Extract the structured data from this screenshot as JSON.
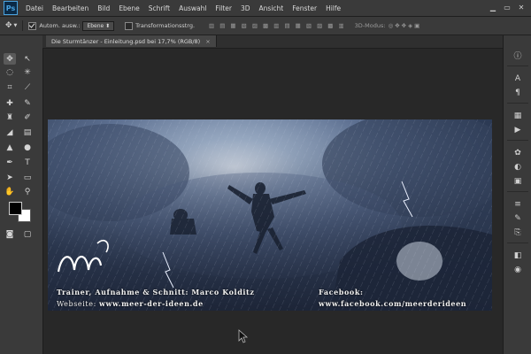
{
  "app": {
    "logo": "Ps"
  },
  "menubar": {
    "items": [
      "Datei",
      "Bearbeiten",
      "Bild",
      "Ebene",
      "Schrift",
      "Auswahl",
      "Filter",
      "3D",
      "Ansicht",
      "Fenster",
      "Hilfe"
    ]
  },
  "options": {
    "auto_select_label": "Autom. ausw.:",
    "auto_select_value": "Ebene",
    "transform_label": "Transformationsstrg.",
    "mode_3d_label": "3D-Modus:"
  },
  "document": {
    "tab_title": "Die Sturmtänzer - Einleitung.psd bei 17,7% (RGB/8)",
    "close": "×",
    "credits_line": "Trainer, Aufnahme & Schnitt: Marco Kolditz",
    "website_label": "Webseite:",
    "website_value": "www.meer-der-ideen.de",
    "facebook_label": "Facebook:",
    "facebook_value": "www.facebook.com/meerderideen"
  },
  "toolbox": {
    "tools": [
      "move",
      "marquee",
      "lasso",
      "quick-select",
      "crop",
      "eyedropper",
      "healing",
      "brush",
      "stamp",
      "history-brush",
      "eraser",
      "gradient",
      "blur",
      "dodge",
      "pen",
      "type",
      "path-select",
      "shape",
      "hand",
      "zoom",
      "quickmask",
      "screenmode"
    ]
  },
  "colors": {
    "ui_dark": "#262626",
    "panel": "#3a3a3a",
    "accent": "#4aa3df",
    "sky": "#6a84a8"
  }
}
